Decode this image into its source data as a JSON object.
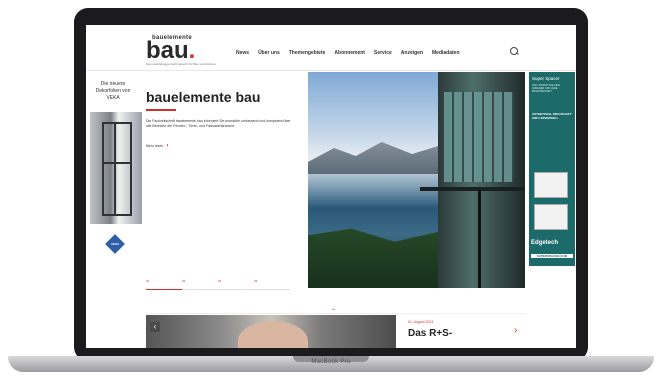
{
  "device": {
    "label": "MacBook Pro"
  },
  "header": {
    "logo_small": "bauelemente",
    "logo_big": "bau",
    "logo_dot": ".",
    "logo_tag": "Das unabhängige Fachmagazin für Bau und Ausbau",
    "nav": [
      "News",
      "Über uns",
      "Themengebiete",
      "Abonnement",
      "Service",
      "Anzeigen",
      "Mediadaten"
    ]
  },
  "left_ad": {
    "text": "Die neuere Dekorfolien von VEKA",
    "logo": "VEKA"
  },
  "hero": {
    "title": "bauelemente bau",
    "body": "Die Fachzeitschrift bauelemente bau informiert Sie monatlich umfassend und kompetent über alle Bereiche der Fenster-, Türen- und Fassadenbranche.",
    "more": "Mehr lesen",
    "slider_nums": [
      "01",
      "02",
      "03",
      "04"
    ]
  },
  "right_ad": {
    "head": "Super Spacer",
    "sub": "HALT WARMT WIE KEIN ANDERER UND JEDE BESONDERHEIT",
    "tag": "ÄSTHETISCH, DRUCKHAFT UND UNIVERSELL",
    "brand": "Edgetech",
    "url": "SUPERSPACER.COM"
  },
  "news": {
    "date": "01. August 2024",
    "title": "Das R+S-"
  },
  "colors": {
    "accent": "#d0312d",
    "ad_teal": "#1c6a6a"
  }
}
